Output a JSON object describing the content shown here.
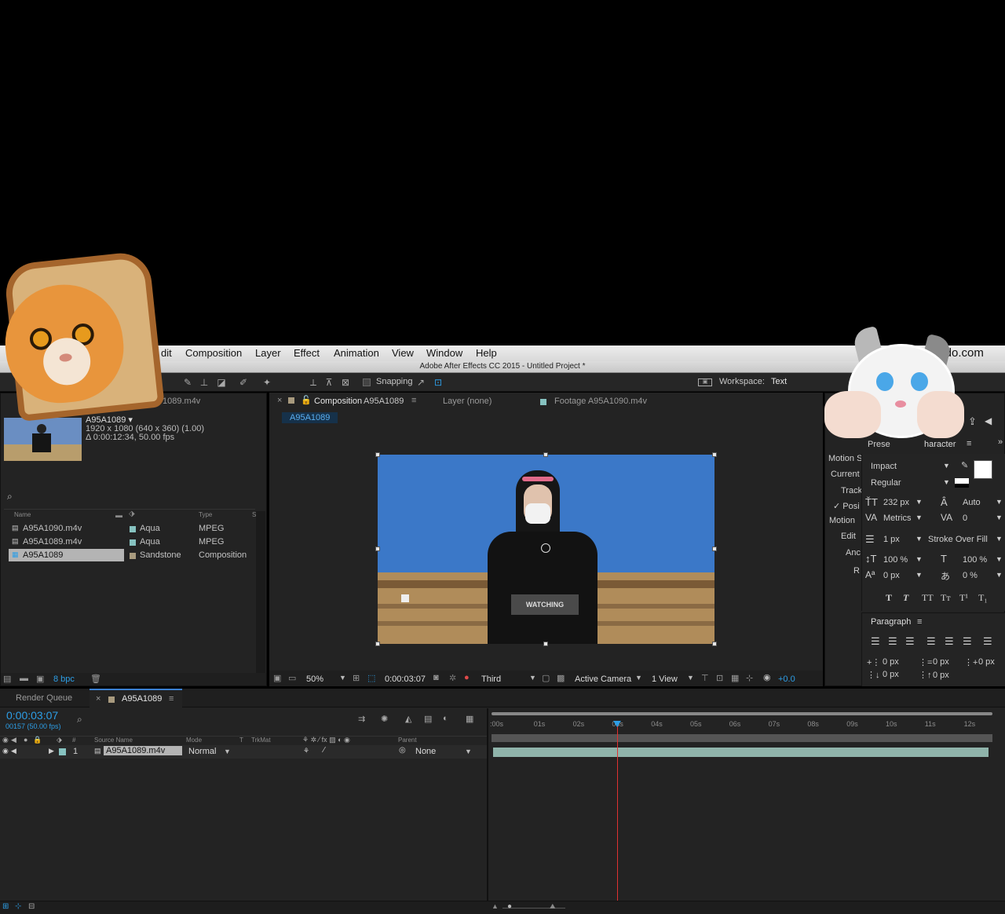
{
  "menubar": {
    "items": [
      "dit",
      "Composition",
      "Layer",
      "Effect",
      "Animation",
      "View",
      "Window",
      "Help"
    ],
    "right_text": "d…udo.com"
  },
  "app_title": "Adobe After Effects CC 2015 - Untitled Project *",
  "toolbar": {
    "snapping_label": "Snapping",
    "workspace_label": "Workspace:",
    "workspace_value": "Text"
  },
  "project": {
    "tab_partial": "1089.m4v",
    "selected_name": "A95A1089 ▾",
    "info_line1": "1920 x 1080  (640 x 360) (1.00)",
    "info_line2": "Δ 0:00:12:34, 50.00 fps",
    "search_icon": "search-icon",
    "columns": {
      "name": "Name",
      "type": "Type",
      "size": "Size"
    },
    "items": [
      {
        "name": "A95A1090.m4v",
        "label": "Aqua",
        "label_color": "#86c2c0",
        "type": "MPEG"
      },
      {
        "name": "A95A1089.m4v",
        "label": "Aqua",
        "label_color": "#86c2c0",
        "type": "MPEG"
      },
      {
        "name": "A95A1089",
        "label": "Sandstone",
        "label_color": "#a89a7e",
        "type": "Composition"
      }
    ],
    "bpc": "8 bpc"
  },
  "viewer": {
    "tab_comp_prefix": "Composition",
    "tab_comp_name": "A95A1089",
    "tab_layer": "Layer (none)",
    "tab_footage": "Footage A95A1090.m4v",
    "comp_chip": "A95A1089",
    "zoom": "50%",
    "timecode": "0:00:03:07",
    "resolution": "Third",
    "camera": "Active Camera",
    "views": "1 View",
    "exposure": "+0.0",
    "shirt_text": "WATCHING"
  },
  "right_panel": {
    "tab_presets": "Prese",
    "tab_character": "haracter",
    "left_labels": [
      "Motion S",
      "Current",
      "Track",
      "✓ Posi",
      "Motion",
      "Edit",
      "Anc",
      "R"
    ],
    "font": "Impact",
    "style": "Regular",
    "font_size": "232 px",
    "leading": "Auto",
    "kerning": "Metrics",
    "tracking": "0",
    "stroke_width": "1 px",
    "stroke_mode": "Stroke Over Fill",
    "vscale": "100 %",
    "hscale": "100 %",
    "baseline": "0 px",
    "tsume": "0 %",
    "paragraph_title": "Paragraph",
    "indent_left": "0 px",
    "indent_first": "0 px",
    "indent_right": "0 px",
    "space_before": "0 px",
    "space_after": "0 px",
    "text_style_buttons": [
      "T",
      "T",
      "TT",
      "Tт",
      "T¹",
      "T₁"
    ]
  },
  "timeline": {
    "tab_render": "Render Queue",
    "tab_comp": "A95A1089",
    "timecode": "0:00:03:07",
    "frame_info": "00157 (50.00 fps)",
    "columns": {
      "source": "Source Name",
      "mode": "Mode",
      "t": "T",
      "trkmat": "TrkMat",
      "parent": "Parent"
    },
    "ruler_ticks": [
      ":00s",
      "01s",
      "02s",
      "03s",
      "04s",
      "05s",
      "06s",
      "07s",
      "08s",
      "09s",
      "10s",
      "11s",
      "12s"
    ],
    "playhead_seconds": 3.14,
    "duration_seconds": 12.68,
    "layers": [
      {
        "index": "1",
        "name": "A95A1089.m4v",
        "mode": "Normal",
        "parent": "None"
      }
    ]
  }
}
